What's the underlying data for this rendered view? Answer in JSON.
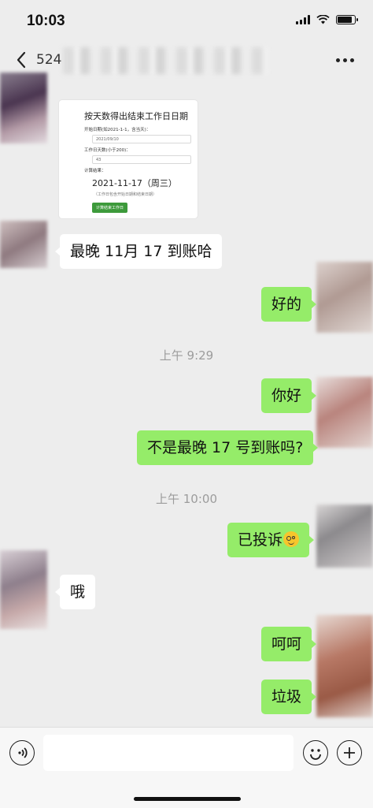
{
  "status_bar": {
    "time": "10:03",
    "battery_level": 0.85
  },
  "nav": {
    "title": "524",
    "icons": [
      "back-icon",
      "more-icon"
    ]
  },
  "image_card": {
    "heading": "按天数得出结束工作日日期",
    "start_label": "开始日期(如2021-1-1，含当天)：",
    "start_value": "2021/09/10",
    "days_label": "工作日天数(小于200)：",
    "days_value": "43",
    "result_label": "计算结果：",
    "result_value": "2021-11-17（周三）",
    "note": "（工作日包含开始日期和结束日期）",
    "button_label": "计算结束工作日"
  },
  "messages": [
    {
      "side": "left",
      "text": "最晚 11月 17 到账哈"
    },
    {
      "side": "right",
      "text": "好的"
    },
    {
      "type": "time",
      "text": "上午 9:29"
    },
    {
      "side": "right",
      "text": "你好"
    },
    {
      "side": "right",
      "text": "不是最晚 17 号到账吗?"
    },
    {
      "type": "time",
      "text": "上午 10:00"
    },
    {
      "side": "right",
      "text": "已投诉",
      "emoji": "flushed-face-icon"
    },
    {
      "side": "left",
      "text": "哦"
    },
    {
      "side": "right",
      "text": "呵呵"
    },
    {
      "side": "right",
      "text": "垃圾"
    }
  ],
  "input_bar": {
    "placeholder": "",
    "icons": [
      "voice-icon",
      "emoji-icon",
      "plus-icon"
    ]
  },
  "colors": {
    "background": "#ededed",
    "bubble_right": "#95ec69",
    "bubble_left": "#ffffff",
    "timestamp": "#9c9c9c"
  }
}
